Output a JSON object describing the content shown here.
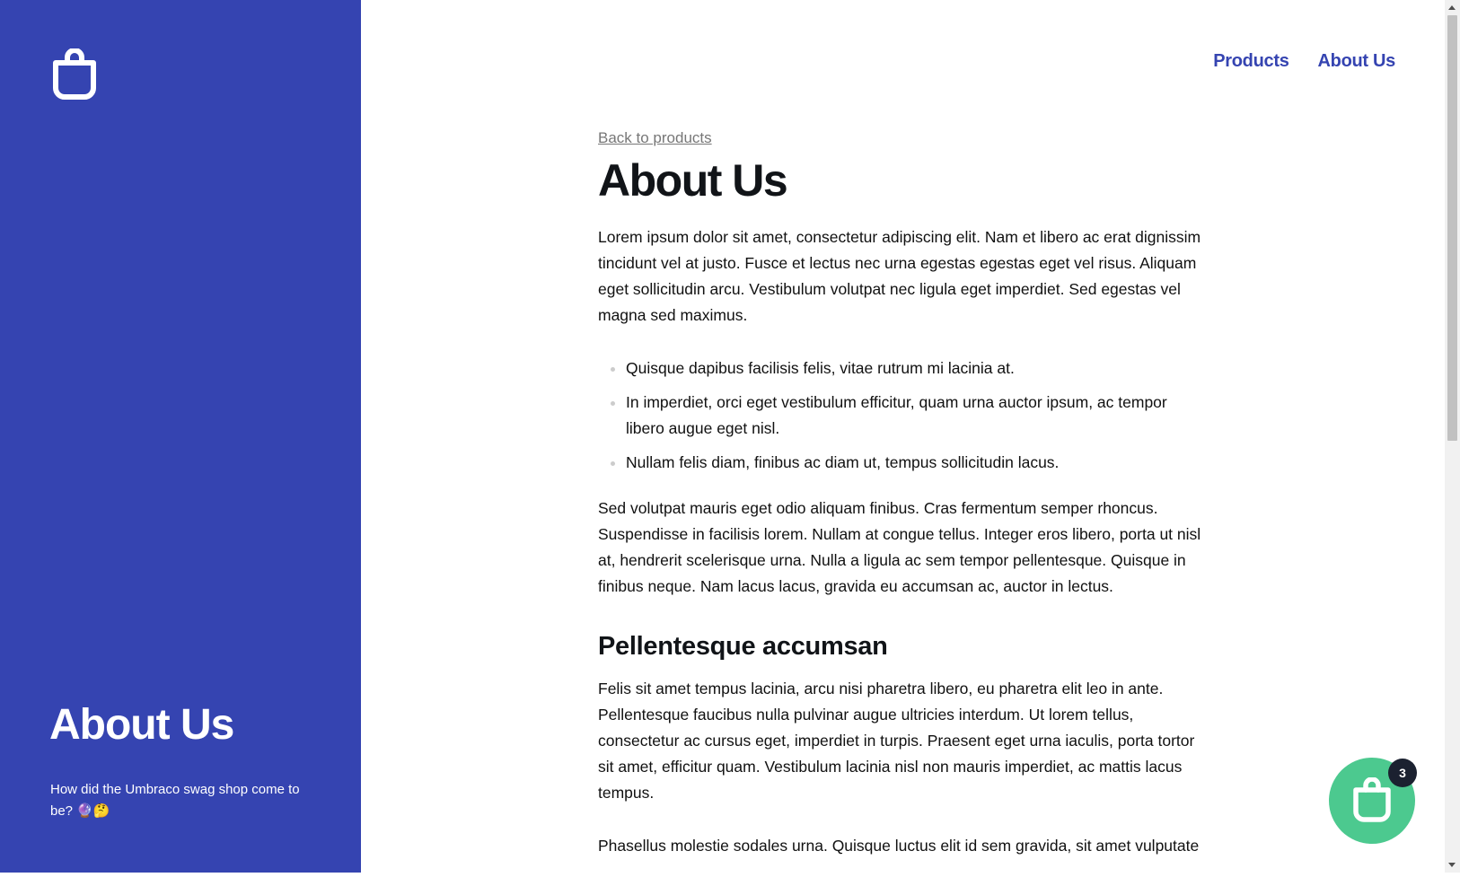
{
  "sidebar": {
    "logo_icon": "shopping-bag-icon",
    "title": "About Us",
    "description": "How did the Umbraco swag shop come to be? 🔮🤔"
  },
  "nav": {
    "products": "Products",
    "about": "About Us"
  },
  "main": {
    "back_link": "Back to products",
    "title": "About Us",
    "intro": "Lorem ipsum dolor sit amet, consectetur adipiscing elit. Nam et libero ac erat dignissim tincidunt vel at justo. Fusce et lectus nec urna egestas egestas eget vel risus. Aliquam eget sollicitudin arcu. Vestibulum volutpat nec ligula eget imperdiet. Sed egestas vel magna sed maximus.",
    "bullets": [
      "Quisque dapibus facilisis felis, vitae rutrum mi lacinia at.",
      "In imperdiet, orci eget vestibulum efficitur, quam urna auctor ipsum, ac tempor libero augue eget nisl.",
      "Nullam felis diam, finibus ac diam ut, tempus sollicitudin lacus."
    ],
    "paragraph2": "Sed volutpat mauris eget odio aliquam finibus. Cras fermentum semper rhoncus. Suspendisse in facilisis lorem. Nullam at congue tellus. Integer eros libero, porta ut nisl at, hendrerit scelerisque urna. Nulla a ligula ac sem tempor pellentesque. Quisque in finibus neque. Nam lacus lacus, gravida eu accumsan ac, auctor in lectus.",
    "section_title": "Pellentesque accumsan",
    "paragraph3": "Felis sit amet tempus lacinia, arcu nisi pharetra libero, eu pharetra elit leo in ante. Pellentesque faucibus nulla pulvinar augue ultricies interdum. Ut lorem tellus, consectetur ac cursus eget, imperdiet in turpis. Praesent eget urna iaculis, porta tortor sit amet, efficitur quam. Vestibulum lacinia nisl non mauris imperdiet, ac mattis lacus tempus.",
    "paragraph4": "Phasellus molestie sodales urna. Quisque luctus elit id sem gravida, sit amet vulputate"
  },
  "cart": {
    "icon": "shopping-bag-icon",
    "count": "3"
  },
  "colors": {
    "brand": "#3544b1",
    "cart": "#4cc98f",
    "badge": "#1b2130"
  }
}
